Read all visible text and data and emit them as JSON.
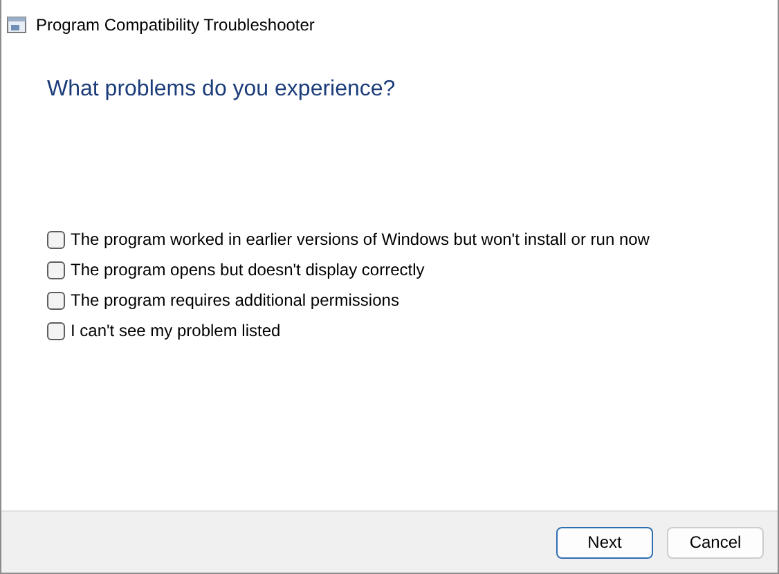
{
  "window": {
    "title": "Program Compatibility Troubleshooter"
  },
  "heading": "What problems do you experience?",
  "options": [
    {
      "label": "The program worked in earlier versions of Windows but won't install or run now",
      "checked": false
    },
    {
      "label": "The program opens but doesn't display correctly",
      "checked": false
    },
    {
      "label": "The program requires additional permissions",
      "checked": false
    },
    {
      "label": "I can't see my problem listed",
      "checked": false
    }
  ],
  "buttons": [
    {
      "label": "Next",
      "kind": "default"
    },
    {
      "label": "Cancel",
      "kind": "normal"
    }
  ]
}
